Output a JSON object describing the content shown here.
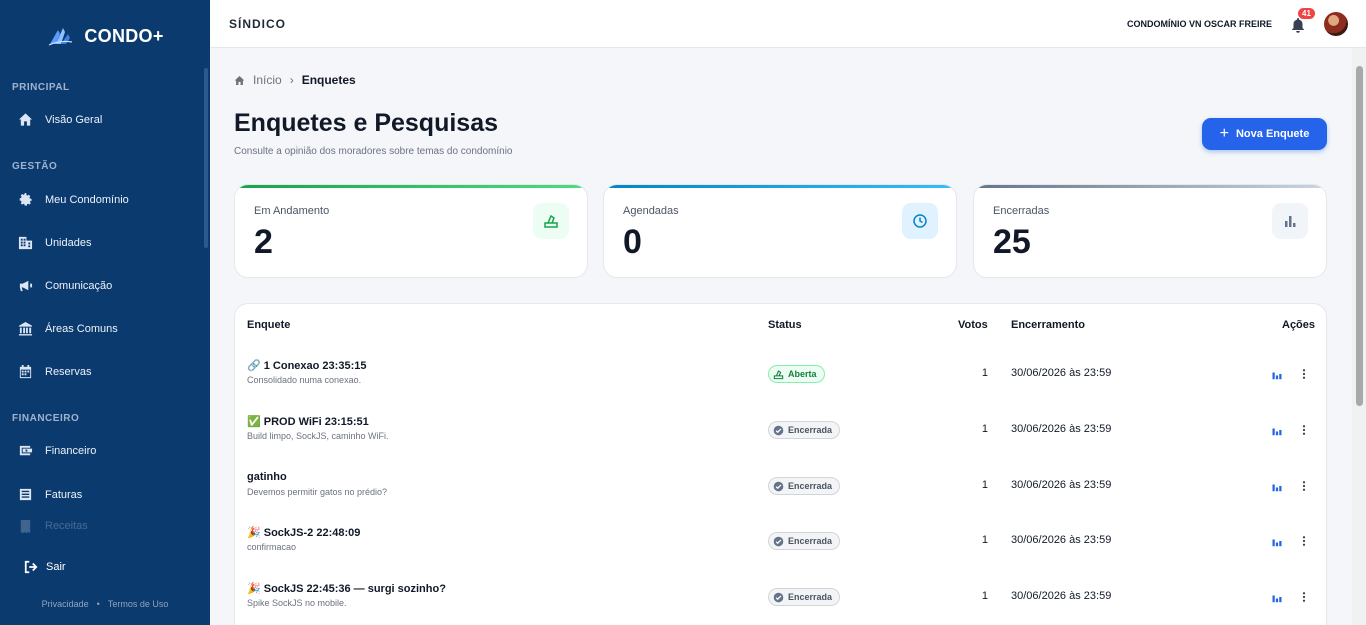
{
  "brand": {
    "name": "CONDO+"
  },
  "sidebar": {
    "sections": [
      {
        "label": "PRINCIPAL"
      },
      {
        "label": "GESTÃO"
      },
      {
        "label": "FINANCEIRO"
      }
    ],
    "items": [
      {
        "label": "Visão Geral",
        "icon": "home-icon"
      },
      {
        "label": "Meu Condomínio",
        "icon": "gear-icon"
      },
      {
        "label": "Unidades",
        "icon": "building-icon"
      },
      {
        "label": "Comunicação",
        "icon": "megaphone-icon"
      },
      {
        "label": "Áreas Comuns",
        "icon": "house-columns-icon"
      },
      {
        "label": "Reservas",
        "icon": "calendar-icon"
      },
      {
        "label": "Financeiro",
        "icon": "wallet-icon"
      },
      {
        "label": "Faturas",
        "icon": "invoice-icon"
      },
      {
        "label": "Receitas",
        "icon": "receipt-icon"
      }
    ],
    "logout": "Sair",
    "footer": {
      "privacy": "Privacidade",
      "separator": "•",
      "terms": "Termos de Uso"
    }
  },
  "header": {
    "role": "SÍNDICO",
    "condo_name": "CONDOMÍNIO VN OSCAR FREIRE",
    "notifications_count": "41"
  },
  "breadcrumb": {
    "home": "Início",
    "current": "Enquetes"
  },
  "page": {
    "title": "Enquetes e Pesquisas",
    "subtitle": "Consulte a opinião dos moradores sobre temas do condomínio",
    "new_button": "Nova Enquete"
  },
  "stats": [
    {
      "label": "Em Andamento",
      "value": "2",
      "color": "#22c55e"
    },
    {
      "label": "Agendadas",
      "value": "0",
      "color": "#0ea5e9"
    },
    {
      "label": "Encerradas",
      "value": "25",
      "color": "#64748b"
    }
  ],
  "table": {
    "headers": {
      "poll": "Enquete",
      "status": "Status",
      "votes": "Votos",
      "closing": "Encerramento",
      "actions": "Ações"
    },
    "rows": [
      {
        "title": "🔗 1 Conexao 23:35:15",
        "desc": "Consolidado numa conexao.",
        "status": "Aberta",
        "open": true,
        "votes": "1",
        "closing": "30/06/2026 às 23:59"
      },
      {
        "title": "✅ PROD WiFi 23:15:51",
        "desc": "Build limpo, SockJS, caminho WiFi.",
        "status": "Encerrada",
        "open": false,
        "votes": "1",
        "closing": "30/06/2026 às 23:59"
      },
      {
        "title": "gatinho",
        "desc": "Devemos permitir gatos no prédio?",
        "status": "Encerrada",
        "open": false,
        "votes": "1",
        "closing": "30/06/2026 às 23:59"
      },
      {
        "title": "🎉 SockJS-2 22:48:09",
        "desc": "confirmacao",
        "status": "Encerrada",
        "open": false,
        "votes": "1",
        "closing": "30/06/2026 às 23:59"
      },
      {
        "title": "🎉 SockJS 22:45:36 — surgi sozinho?",
        "desc": "Spike SockJS no mobile.",
        "status": "Encerrada",
        "open": false,
        "votes": "1",
        "closing": "30/06/2026 às 23:59"
      }
    ]
  }
}
